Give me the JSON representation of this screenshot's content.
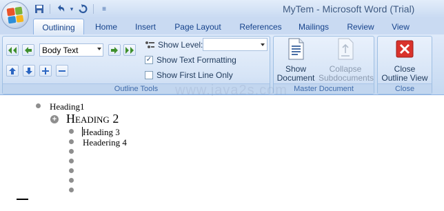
{
  "window": {
    "title": "MyTem - Microsoft Word (Trial)"
  },
  "quick_access": [
    {
      "name": "save-icon",
      "glyph": "💾"
    },
    {
      "name": "undo-icon",
      "glyph": "↶"
    },
    {
      "name": "dropdown-icon",
      "glyph": "▾"
    },
    {
      "name": "redo-icon",
      "glyph": "↻"
    },
    {
      "name": "customize-icon",
      "glyph": "≡"
    }
  ],
  "tabs": [
    {
      "label": "Outlining",
      "active": true
    },
    {
      "label": "Home"
    },
    {
      "label": "Insert"
    },
    {
      "label": "Page Layout"
    },
    {
      "label": "References"
    },
    {
      "label": "Mailings"
    },
    {
      "label": "Review"
    },
    {
      "label": "View"
    }
  ],
  "outline_tools": {
    "group_label": "Outline Tools",
    "level_value": "Body Text",
    "show_level_label": "Show Level:",
    "show_level_value": "",
    "show_text_formatting": {
      "label": "Show Text Formatting",
      "checked": true
    },
    "show_first_line_only": {
      "label": "Show First Line Only",
      "checked": false
    }
  },
  "master_document": {
    "group_label": "Master Document",
    "show_document_line1": "Show",
    "show_document_line2": "Document",
    "collapse_line1": "Collapse",
    "collapse_line2": "Subdocuments"
  },
  "close_group": {
    "group_label": "Close",
    "close_line1": "Close",
    "close_line2": "Outline View"
  },
  "document": {
    "lines": [
      "Heading1",
      "Heading 2",
      "Heading 3",
      "Headering 4"
    ]
  },
  "watermark": "www.java2s.com",
  "colors": {
    "ribbon": "#c5d9f1",
    "accent": "#15428b",
    "close_icon": "#d9322b"
  }
}
